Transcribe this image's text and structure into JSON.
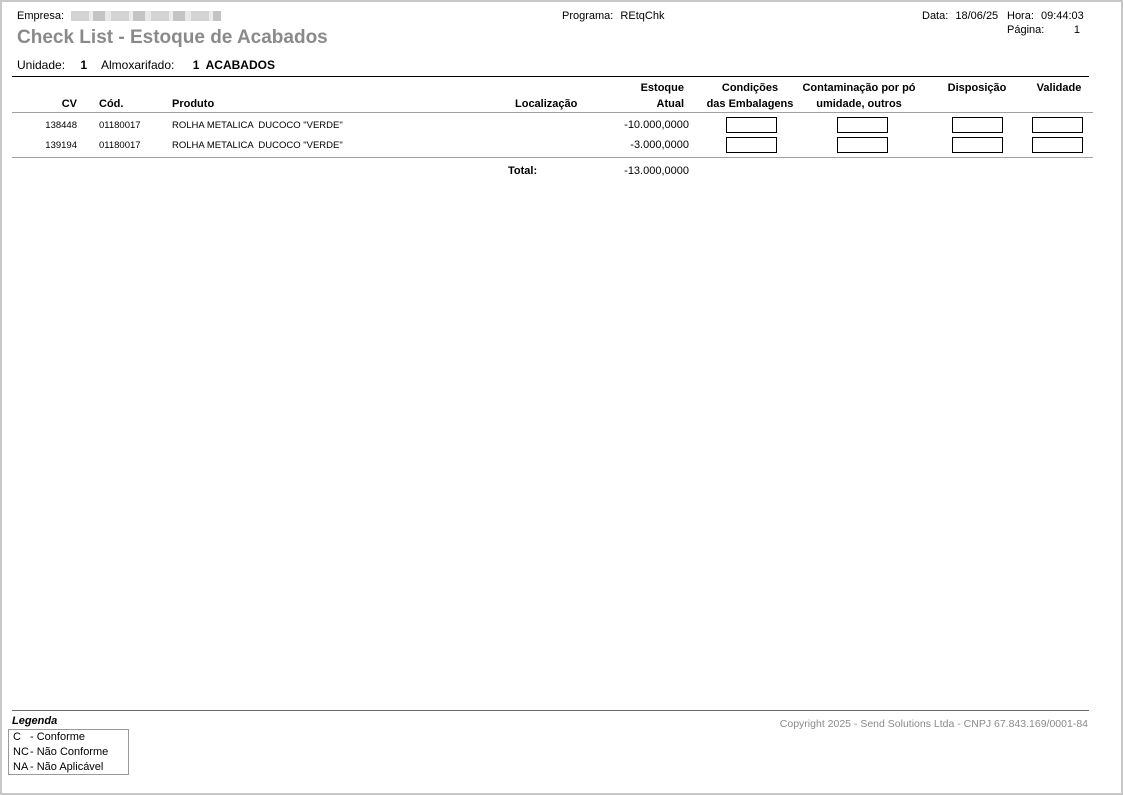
{
  "header": {
    "empresa_label": "Empresa:",
    "programa_label": "Programa:",
    "programa_value": "REtqChk",
    "data_label": "Data:",
    "data_value": "18/06/25",
    "hora_label": "Hora:",
    "hora_value": "09:44:03",
    "pagina_label": "Página:",
    "pagina_value": "1",
    "title": "Check List - Estoque de Acabados",
    "unidade_label": "Unidade:",
    "unidade_value": "1",
    "almox_label": "Almoxarifado:",
    "almox_value": "1  ACABADOS"
  },
  "columns": {
    "cv": "CV",
    "cod": "Cód.",
    "produto": "Produto",
    "localizacao": "Localização",
    "estoque_1": "Estoque",
    "estoque_2": "Atual",
    "condicoes_1": "Condições",
    "condicoes_2": "das Embalagens",
    "contaminacao_1": "Contaminação por pó",
    "contaminacao_2": "umidade, outros",
    "disposicao": "Disposição",
    "validade": "Validade"
  },
  "rows": [
    {
      "cv": "138448",
      "cod": "01180017",
      "produto": "ROLHA METALICA  DUCOCO \"VERDE\"",
      "localizacao": "",
      "estoque": "-10.000,0000"
    },
    {
      "cv": "139194",
      "cod": "01180017",
      "produto": "ROLHA METALICA  DUCOCO \"VERDE\"",
      "localizacao": "",
      "estoque": "-3.000,0000"
    }
  ],
  "total": {
    "label": "Total:",
    "value": "-13.000,0000"
  },
  "legend": {
    "title": "Legenda",
    "items": [
      {
        "code": "C",
        "text": "- Conforme"
      },
      {
        "code": "NC",
        "text": "- Não Conforme"
      },
      {
        "code": "NA",
        "text": "- Não Aplicável"
      }
    ]
  },
  "footer": {
    "copyright": "Copyright 2025 - Send Solutions Ltda - CNPJ 67.843.169/0001-84"
  }
}
